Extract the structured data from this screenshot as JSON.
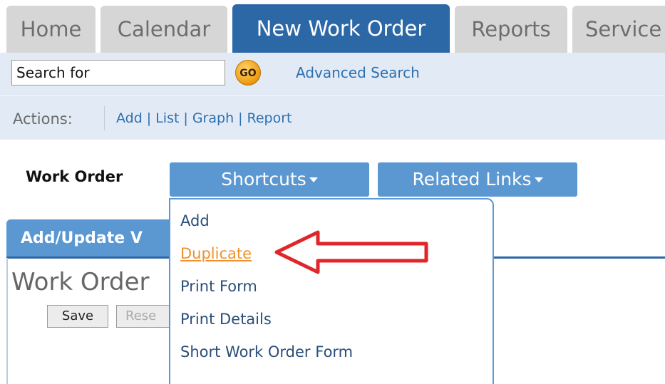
{
  "tabs": [
    {
      "label": "Home"
    },
    {
      "label": "Calendar"
    },
    {
      "label": "New Work Order"
    },
    {
      "label": "Reports"
    },
    {
      "label": "Service"
    }
  ],
  "search": {
    "value": "Search for",
    "go_label": "GO",
    "advanced_label": "Advanced Search"
  },
  "actions": {
    "label": "Actions:",
    "links": [
      "Add",
      "List",
      "Graph",
      "Report"
    ]
  },
  "page": {
    "section_label": "Work Order",
    "shortcuts_label": "Shortcuts",
    "related_label": "Related Links",
    "panel_tab_label": "Add/Update V",
    "form_title": "Work Order",
    "save_label": "Save",
    "reset_label": "Rese"
  },
  "menu": {
    "items": [
      "Add",
      "Duplicate",
      "Print Form",
      "Print Details",
      "Short Work Order Form"
    ]
  },
  "colors": {
    "active_tab": "#2c67a6",
    "button_blue": "#5b97d1",
    "bar_bg": "#e2ebf5",
    "link": "#2d6fb0",
    "highlight": "#f0902a",
    "annotation": "#e0262a"
  }
}
